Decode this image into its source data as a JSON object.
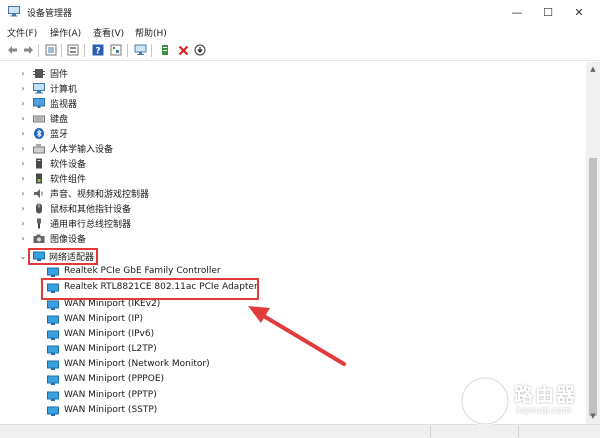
{
  "window": {
    "title": "设备管理器",
    "controls": {
      "minimize": "—",
      "maximize": "☐",
      "close": "✕"
    }
  },
  "menubar": [
    {
      "label": "文件(F)"
    },
    {
      "label": "操作(A)"
    },
    {
      "label": "查看(V)"
    },
    {
      "label": "帮助(H)"
    }
  ],
  "toolbar": {
    "icons": [
      "back-icon",
      "forward-icon",
      "device-view-icon",
      "properties-icon",
      "help-icon",
      "resource-view-icon",
      "scan-hardware-icon",
      "add-driver-icon",
      "uninstall-icon",
      "update-driver-icon"
    ]
  },
  "tree": {
    "categories": [
      {
        "label": "固件",
        "icon": "firmware-icon",
        "expanded": false
      },
      {
        "label": "计算机",
        "icon": "computer-icon",
        "expanded": false
      },
      {
        "label": "监视器",
        "icon": "monitor-icon",
        "expanded": false
      },
      {
        "label": "键盘",
        "icon": "keyboard-icon",
        "expanded": false
      },
      {
        "label": "蓝牙",
        "icon": "bluetooth-icon",
        "expanded": false
      },
      {
        "label": "人体学输入设备",
        "icon": "hid-icon",
        "expanded": false
      },
      {
        "label": "软件设备",
        "icon": "software-device-icon",
        "expanded": false
      },
      {
        "label": "软件组件",
        "icon": "software-component-icon",
        "expanded": false
      },
      {
        "label": "声音、视频和游戏控制器",
        "icon": "sound-icon",
        "expanded": false
      },
      {
        "label": "鼠标和其他指针设备",
        "icon": "mouse-icon",
        "expanded": false
      },
      {
        "label": "通用串行总线控制器",
        "icon": "usb-icon",
        "expanded": false
      },
      {
        "label": "图像设备",
        "icon": "camera-icon",
        "expanded": false
      },
      {
        "label": "网络适配器",
        "icon": "network-adapter-icon",
        "expanded": true
      }
    ],
    "network_adapters": [
      {
        "label": "Realtek PCIe GbE Family Controller"
      },
      {
        "label": "Realtek RTL8821CE 802.11ac PCIe Adapter",
        "highlighted": true
      },
      {
        "label": "WAN Miniport (IKEv2)"
      },
      {
        "label": "WAN Miniport (IP)"
      },
      {
        "label": "WAN Miniport (IPv6)"
      },
      {
        "label": "WAN Miniport (L2TP)"
      },
      {
        "label": "WAN Miniport (Network Monitor)"
      },
      {
        "label": "WAN Miniport (PPPOE)"
      },
      {
        "label": "WAN Miniport (PPTP)"
      },
      {
        "label": "WAN Miniport (SSTP)"
      }
    ]
  },
  "annotation": {
    "color": "#e23b3b"
  },
  "watermark": {
    "name": "路由器",
    "url": "luyouqi.com"
  }
}
